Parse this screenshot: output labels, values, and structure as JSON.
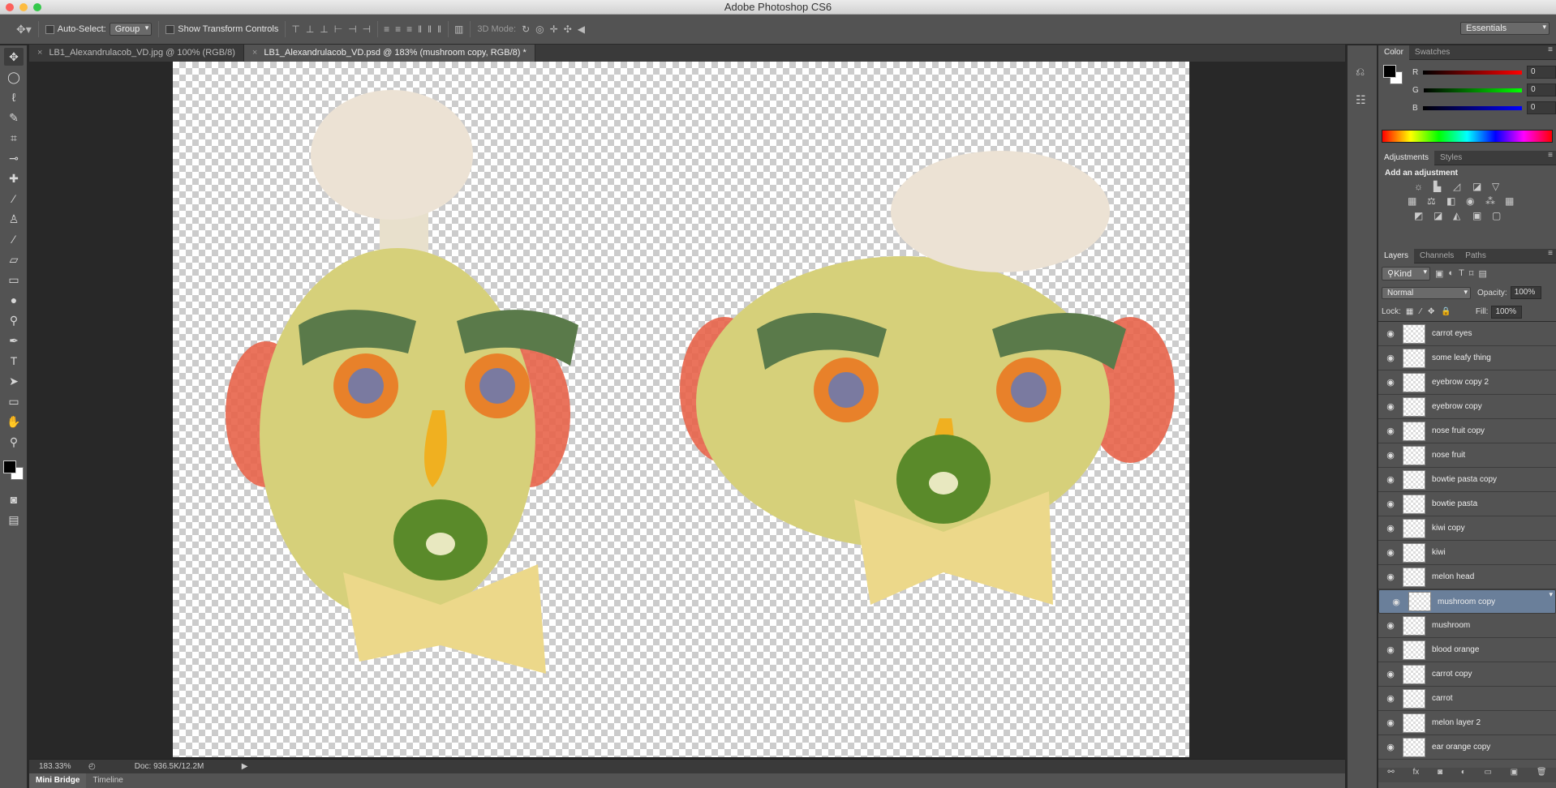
{
  "app": {
    "title": "Adobe Photoshop CS6"
  },
  "options": {
    "auto_select_label": "Auto-Select:",
    "auto_select_value": "Group",
    "show_transform_label": "Show Transform Controls",
    "mode_3d_label": "3D Mode:",
    "workspace": "Essentials"
  },
  "doc_tabs": [
    {
      "label": "LB1_Alexandrulacob_VD.jpg @ 100% (RGB/8)"
    },
    {
      "label": "LB1_Alexandrulacob_VD.psd @ 183% (mushroom copy, RGB/8) *"
    }
  ],
  "status": {
    "zoom": "183.33%",
    "doc": "Doc: 936.5K/12.2M"
  },
  "bottom_tabs": [
    "Mini Bridge",
    "Timeline"
  ],
  "color_panel": {
    "tabs": [
      "Color",
      "Swatches"
    ],
    "r": "0",
    "g": "0",
    "b": "0",
    "r_label": "R",
    "g_label": "G",
    "b_label": "B"
  },
  "adjust_panel": {
    "tabs": [
      "Adjustments",
      "Styles"
    ],
    "heading": "Add an adjustment"
  },
  "layers_panel": {
    "tabs": [
      "Layers",
      "Channels",
      "Paths"
    ],
    "kind": "Kind",
    "blend": "Normal",
    "opacity_label": "Opacity:",
    "opacity": "100%",
    "lock_label": "Lock:",
    "fill_label": "Fill:",
    "fill": "100%",
    "layers": [
      "carrot eyes",
      "some leafy thing",
      "eyebrow copy 2",
      "eyebrow copy",
      "nose fruit copy",
      "nose fruit",
      "bowtie pasta copy",
      "bowtie pasta",
      "kiwi copy",
      "kiwi",
      "melon head",
      "mushroom copy",
      "mushroom",
      "blood orange",
      "carrot copy",
      "carrot",
      "melon layer 2",
      "ear orange copy"
    ],
    "selected": "mushroom copy"
  },
  "icons": [
    "move-icon",
    "marquee-icon",
    "lasso-icon",
    "quick-select-icon",
    "crop-icon",
    "eyedropper-icon",
    "healing-icon",
    "brush-icon",
    "stamp-icon",
    "history-brush-icon",
    "eraser-icon",
    "gradient-icon",
    "blur-icon",
    "dodge-icon",
    "pen-icon",
    "type-icon",
    "path-select-icon",
    "shape-icon",
    "hand-icon",
    "zoom-icon"
  ]
}
